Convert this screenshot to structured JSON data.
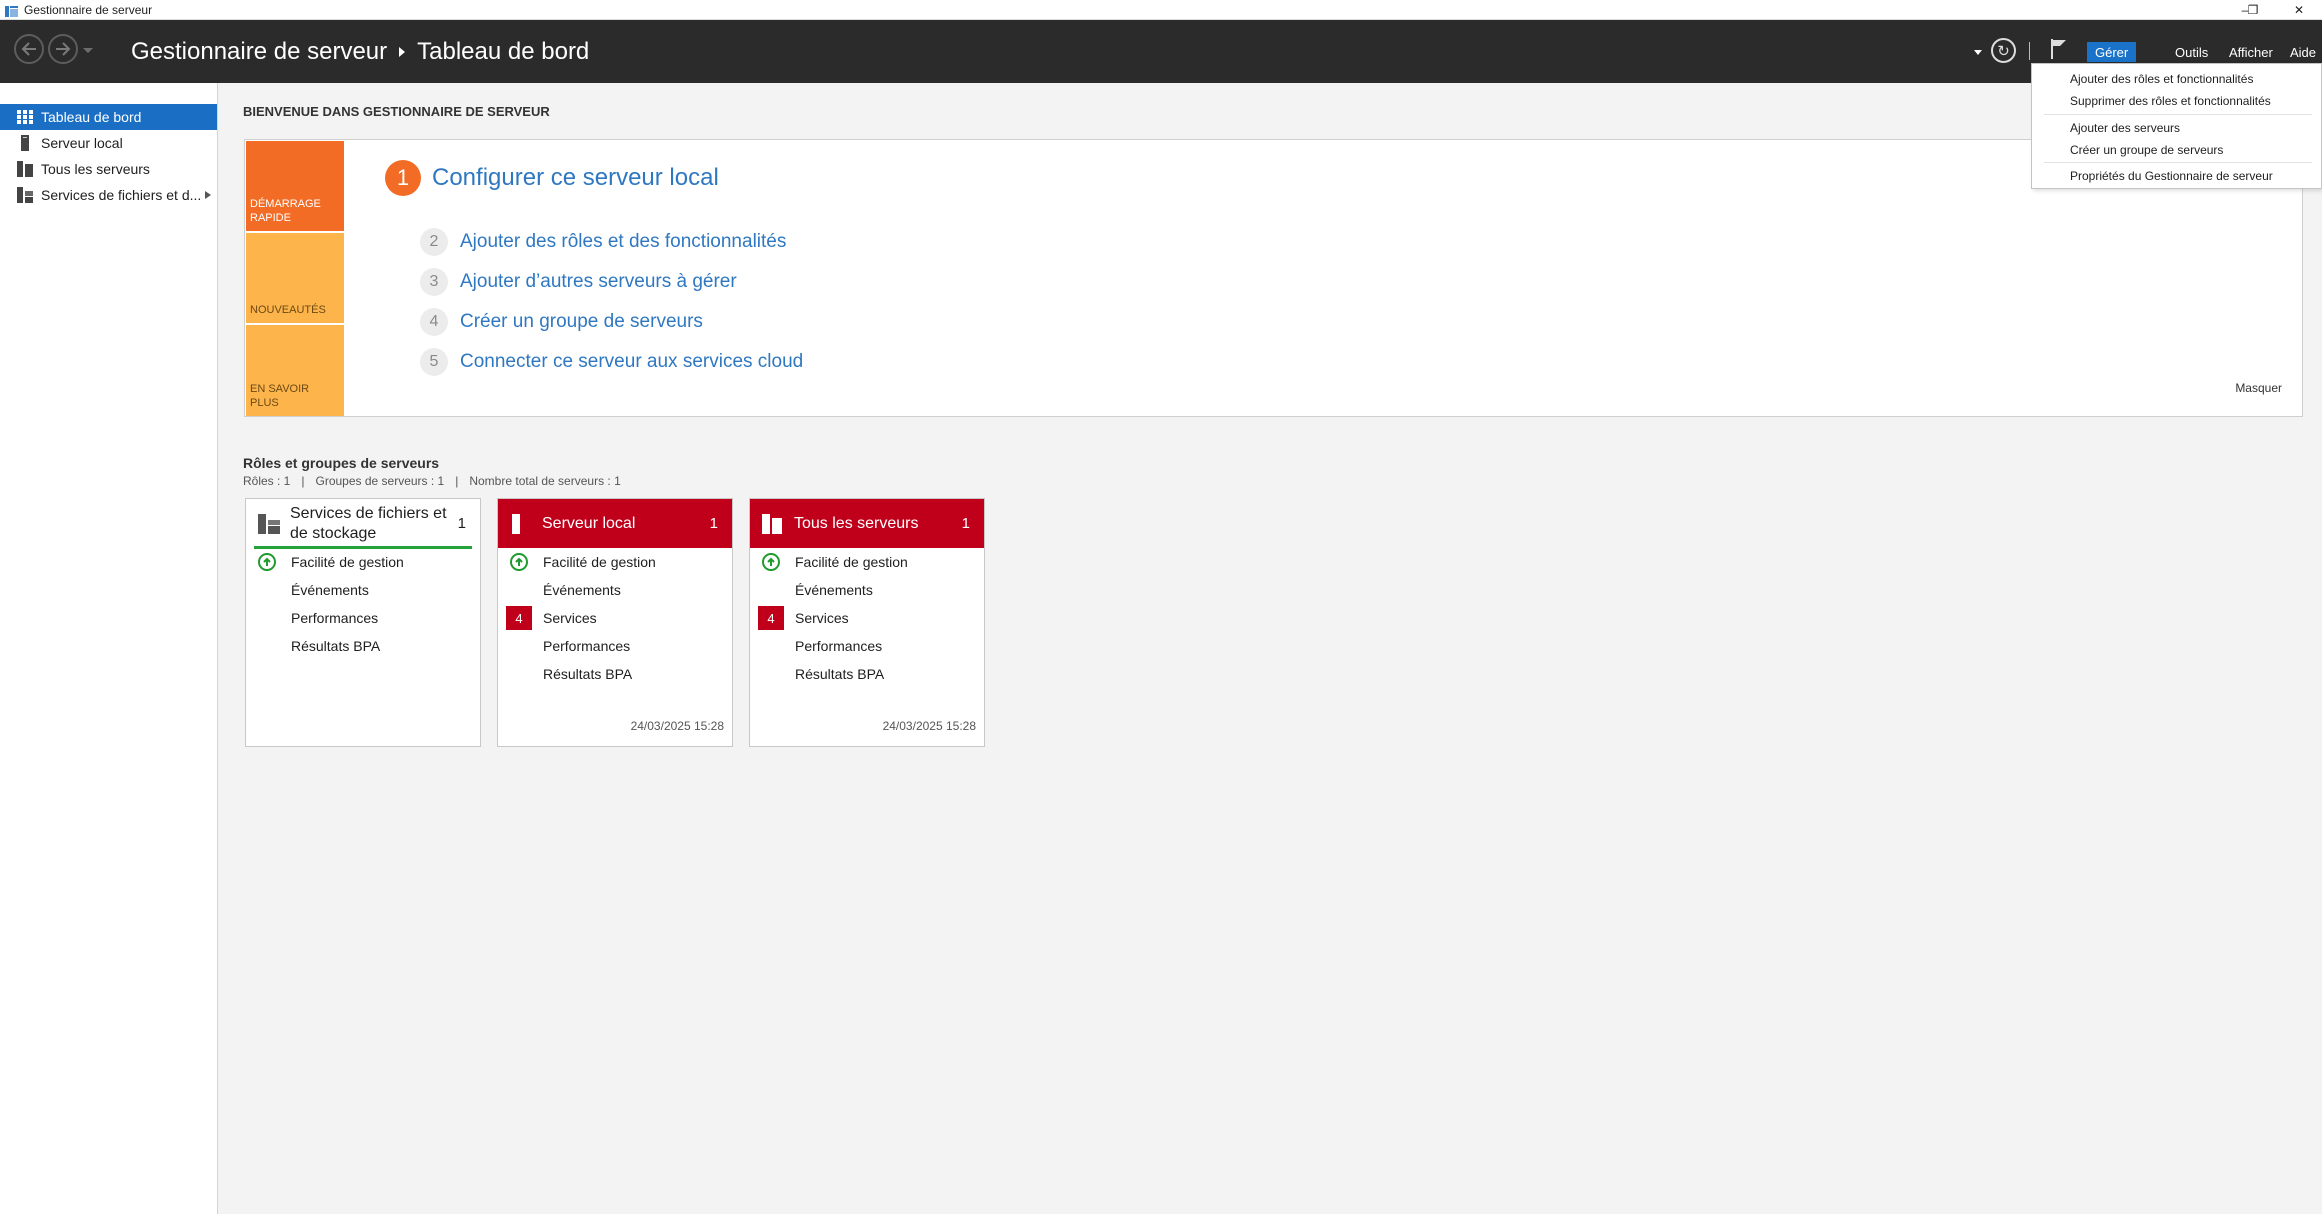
{
  "window": {
    "title": "Gestionnaire de serveur",
    "minimize": "–",
    "restore": "❐",
    "close": "✕"
  },
  "header": {
    "back_icon": "arrow-left-icon",
    "forward_icon": "arrow-right-icon",
    "breadcrumb_root": "Gestionnaire de serveur",
    "breadcrumb_current": "Tableau de bord",
    "refresh_glyph": "↻",
    "menus": [
      "Gérer",
      "Outils",
      "Afficher",
      "Aide"
    ]
  },
  "sidebar": {
    "items": [
      {
        "label": "Tableau de bord",
        "icon": "dashboard-icon"
      },
      {
        "label": "Serveur local",
        "icon": "server-icon"
      },
      {
        "label": "Tous les serveurs",
        "icon": "servers-icon"
      },
      {
        "label": "Services de fichiers et d...",
        "icon": "file-services-icon"
      }
    ]
  },
  "main": {
    "welcome": "BIENVENUE DANS GESTIONNAIRE DE SERVEUR",
    "tiles": [
      "DÉMARRAGE RAPIDE",
      "NOUVEAUTÉS",
      "EN SAVOIR PLUS"
    ],
    "steps": [
      {
        "num": "1",
        "label": "Configurer ce serveur local"
      },
      {
        "num": "2",
        "label": "Ajouter des rôles et des fonctionnalités"
      },
      {
        "num": "3",
        "label": "Ajouter d’autres serveurs à gérer"
      },
      {
        "num": "4",
        "label": "Créer un groupe de serveurs"
      },
      {
        "num": "5",
        "label": "Connecter ce serveur aux services cloud"
      }
    ],
    "hide": "Masquer",
    "roles_title": "Rôles et groupes de serveurs",
    "roles_summary": {
      "roles": "Rôles : 1",
      "groups": "Groupes de serveurs : 1",
      "total": "Nombre total de serveurs : 1",
      "sep": "|"
    }
  },
  "cards": [
    {
      "title_line1": "Services de fichiers et",
      "title_line2": "de stockage",
      "count": "1",
      "rows": [
        "Facilité de gestion",
        "Événements",
        "Performances",
        "Résultats BPA"
      ],
      "date": ""
    },
    {
      "title": "Serveur local",
      "count": "1",
      "rows": [
        "Facilité de gestion",
        "Événements",
        "Services",
        "Performances",
        "Résultats BPA"
      ],
      "services_badge": "4",
      "date": "24/03/2025 15:28"
    },
    {
      "title": "Tous les serveurs",
      "count": "1",
      "rows": [
        "Facilité de gestion",
        "Événements",
        "Services",
        "Performances",
        "Résultats BPA"
      ],
      "services_badge": "4",
      "date": "24/03/2025 15:28"
    }
  ],
  "dropdown": {
    "items": [
      "Ajouter des rôles et fonctionnalités",
      "Supprimer des rôles et fonctionnalités",
      "Ajouter des serveurs",
      "Créer un groupe de serveurs",
      "Propriétés du Gestionnaire de serveur"
    ]
  },
  "colors": {
    "header_bg": "#2b2b2b",
    "accent_blue": "#1a6fc5",
    "link_blue": "#2f78c1",
    "quick_orange": "#f26c25",
    "quick_yellow": "#fdb44b",
    "alert_red": "#c0001b",
    "ok_green": "#1f9b2e"
  }
}
